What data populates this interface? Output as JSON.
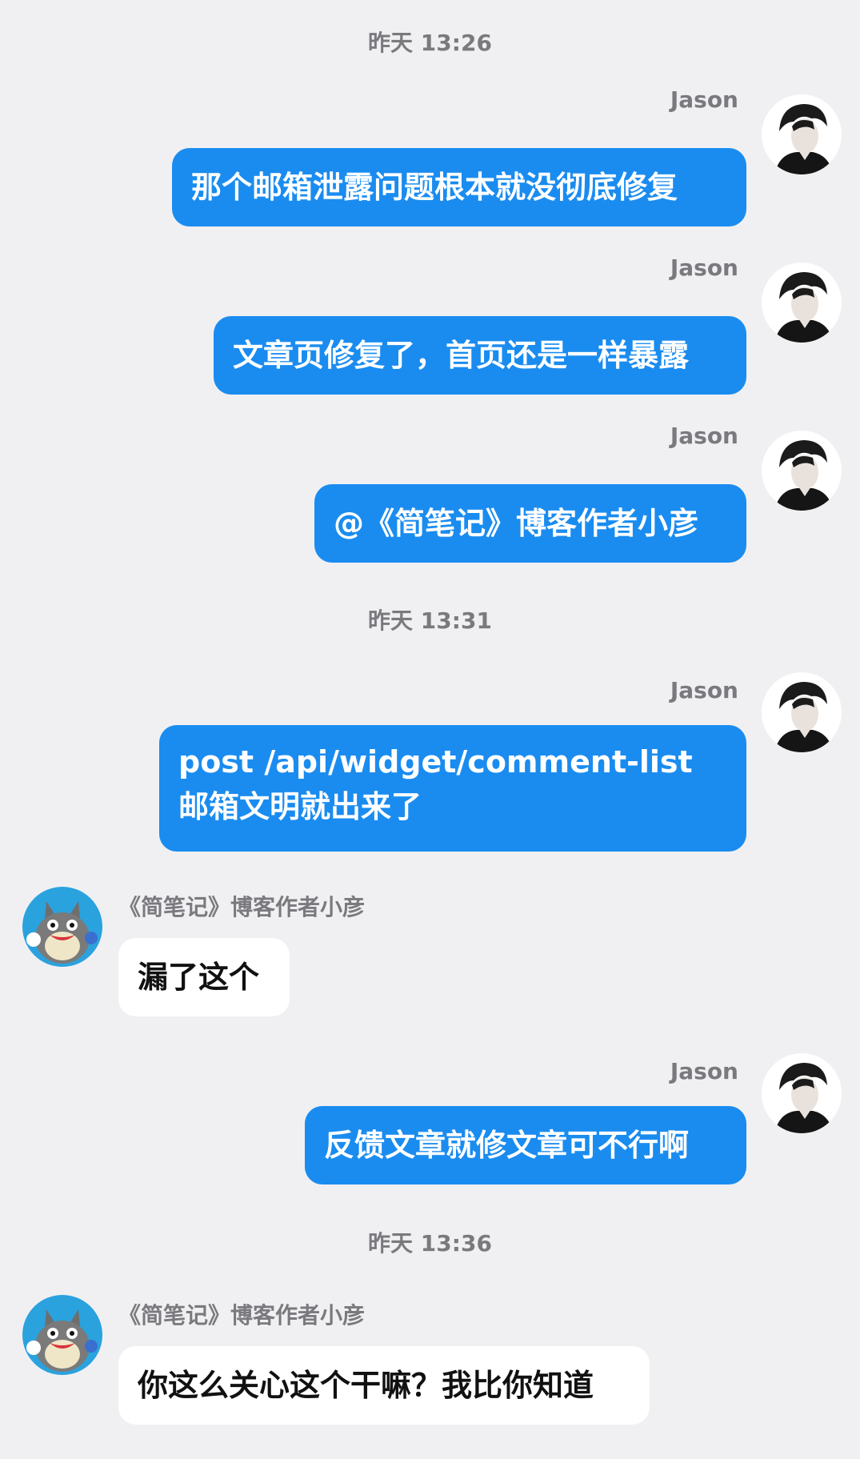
{
  "timestamps": [
    "昨天 13:26",
    "昨天 13:31",
    "昨天 13:36"
  ],
  "messages": [
    {
      "sender": "Jason",
      "text": "那个邮箱泄露问题根本就没彻底修复"
    },
    {
      "sender": "Jason",
      "text": "文章页修复了，首页还是一样暴露"
    },
    {
      "sender": "Jason",
      "text": "@《简笔记》博客作者小彦"
    },
    {
      "sender": "Jason",
      "text": "post /api/widget/comment-list\n邮箱文明就出来了"
    },
    {
      "sender": "《简笔记》博客作者小彦",
      "text": "漏了这个"
    },
    {
      "sender": "Jason",
      "text": "反馈文章就修文章可不行啊"
    },
    {
      "sender": "《简笔记》博客作者小彦",
      "text": "你这么关心这个干嘛？我比你知道"
    }
  ],
  "colors": {
    "background": "#f0f0f3",
    "my_bubble": "#1a8cf0",
    "other_bubble": "#ffffff",
    "meta_text": "#7a7a7e"
  },
  "icons": {
    "self_avatar": "jason-avatar-icon",
    "other_avatar": "totoro-avatar-icon"
  }
}
